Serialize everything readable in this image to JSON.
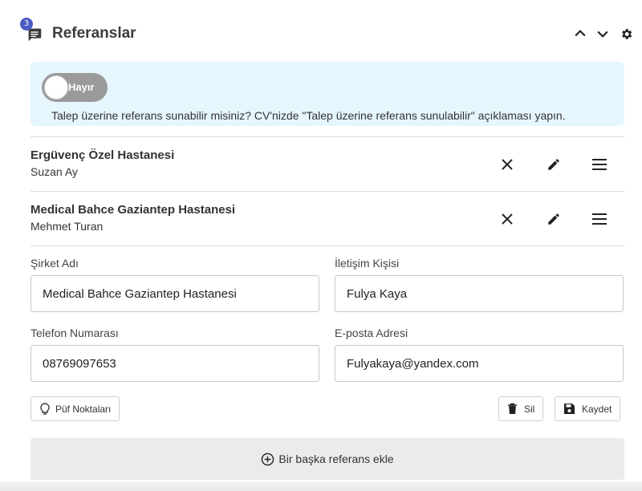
{
  "header": {
    "title": "Referanslar",
    "badge_count": "3",
    "icons": [
      "comment-icon",
      "chevron-up-icon",
      "chevron-down-icon",
      "gear-icon"
    ]
  },
  "availability": {
    "toggle_label": "Hayır",
    "toggle_on": false,
    "description": "Talep üzerine referans sunabilir misiniz? CV'nizde \"Talep üzerine referans sunulabilir\" açıklaması yapın."
  },
  "references": [
    {
      "company": "Ergüvenç Özel Hastanesi",
      "person": "Suzan Ay"
    },
    {
      "company": "Medical Bahce Gaziantep Hastanesi",
      "person": "Mehmet Turan"
    }
  ],
  "form": {
    "company_label": "Şirket Adı",
    "company_value": "Medical Bahce Gaziantep Hastanesi",
    "contact_label": "İletişim Kişisi",
    "contact_value": "Fulya Kaya",
    "phone_label": "Telefon Numarası",
    "phone_value": "08769097653",
    "email_label": "E-posta Adresi",
    "email_value": "Fulyakaya@yandex.com"
  },
  "actions": {
    "tips_label": "Püf Noktaları",
    "delete_label": "Sil",
    "save_label": "Kaydet",
    "add_label": "Bir başka referans ekle"
  },
  "colors": {
    "accent": "#4a5bc4",
    "info_bg": "#e6f6fd",
    "toggle_off": "#9a9a9a",
    "add_bg": "#ebebeb"
  }
}
